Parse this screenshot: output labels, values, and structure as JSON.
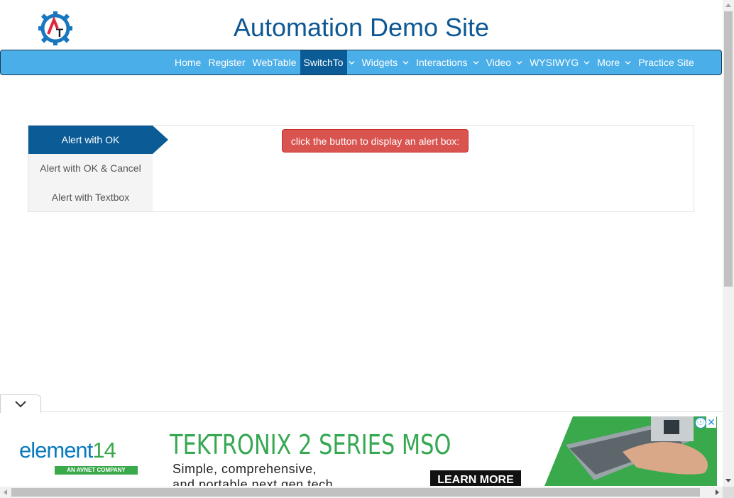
{
  "header": {
    "site_title": "Automation Demo Site",
    "logo_icon": "gear-logo-icon"
  },
  "nav": {
    "items": [
      {
        "label": "Home",
        "dropdown": false,
        "active": false
      },
      {
        "label": "Register",
        "dropdown": false,
        "active": false
      },
      {
        "label": "WebTable",
        "dropdown": false,
        "active": false
      },
      {
        "label": "SwitchTo",
        "dropdown": true,
        "active": true
      },
      {
        "label": "Widgets",
        "dropdown": true,
        "active": false
      },
      {
        "label": "Interactions",
        "dropdown": true,
        "active": false
      },
      {
        "label": "Video",
        "dropdown": true,
        "active": false
      },
      {
        "label": "WYSIWYG",
        "dropdown": true,
        "active": false
      },
      {
        "label": "More",
        "dropdown": true,
        "active": false
      },
      {
        "label": "Practice Site",
        "dropdown": false,
        "active": false
      }
    ]
  },
  "alerts": {
    "tabs": [
      {
        "label": "Alert with OK",
        "active": true
      },
      {
        "label": "Alert with OK & Cancel",
        "active": false
      },
      {
        "label": "Alert with Textbox",
        "active": false
      }
    ],
    "button_label": "click the button to display an alert box:"
  },
  "ad": {
    "brand_prefix": "element",
    "brand_number": "14",
    "brand_sub": "AN AVNET COMPANY",
    "headline": "TEKTRONIX 2 SERIES MSO",
    "line1": "Simple, comprehensive,",
    "line2": "and portable next gen tech",
    "cta": "LEARN MORE",
    "info_icon": "ⓘ",
    "close_icon": "✕"
  },
  "colors": {
    "navbar": "#4aaee8",
    "active": "#0a5b96",
    "title": "#0d5894",
    "alert_button": "#d9534f"
  }
}
